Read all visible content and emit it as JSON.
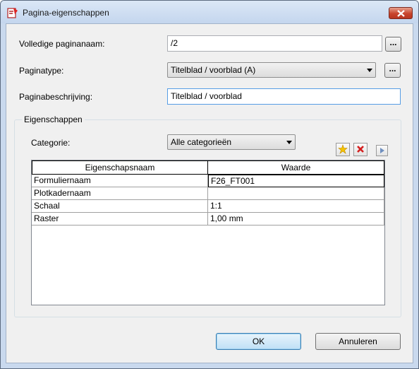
{
  "window": {
    "title": "Pagina-eigenschappen"
  },
  "fields": {
    "full_name_label": "Volledige paginanaam:",
    "full_name_value": "/2",
    "page_type_label": "Paginatype:",
    "page_type_value": "Titelblad / voorblad (A)",
    "description_label": "Paginabeschrijving:",
    "description_value": "Titelblad / voorblad",
    "browse_label": "..."
  },
  "properties": {
    "group_label": "Eigenschappen",
    "category_label": "Categorie:",
    "category_value": "Alle categorieën",
    "columns": [
      "Eigenschapsnaam",
      "Waarde"
    ],
    "rows": [
      {
        "name": "Formuliernaam",
        "value": "F26_FT001"
      },
      {
        "name": "Plotkadernaam",
        "value": ""
      },
      {
        "name": "Schaal",
        "value": "1:1"
      },
      {
        "name": "Raster",
        "value": "1,00 mm"
      }
    ]
  },
  "buttons": {
    "ok": "OK",
    "cancel": "Annuleren"
  }
}
